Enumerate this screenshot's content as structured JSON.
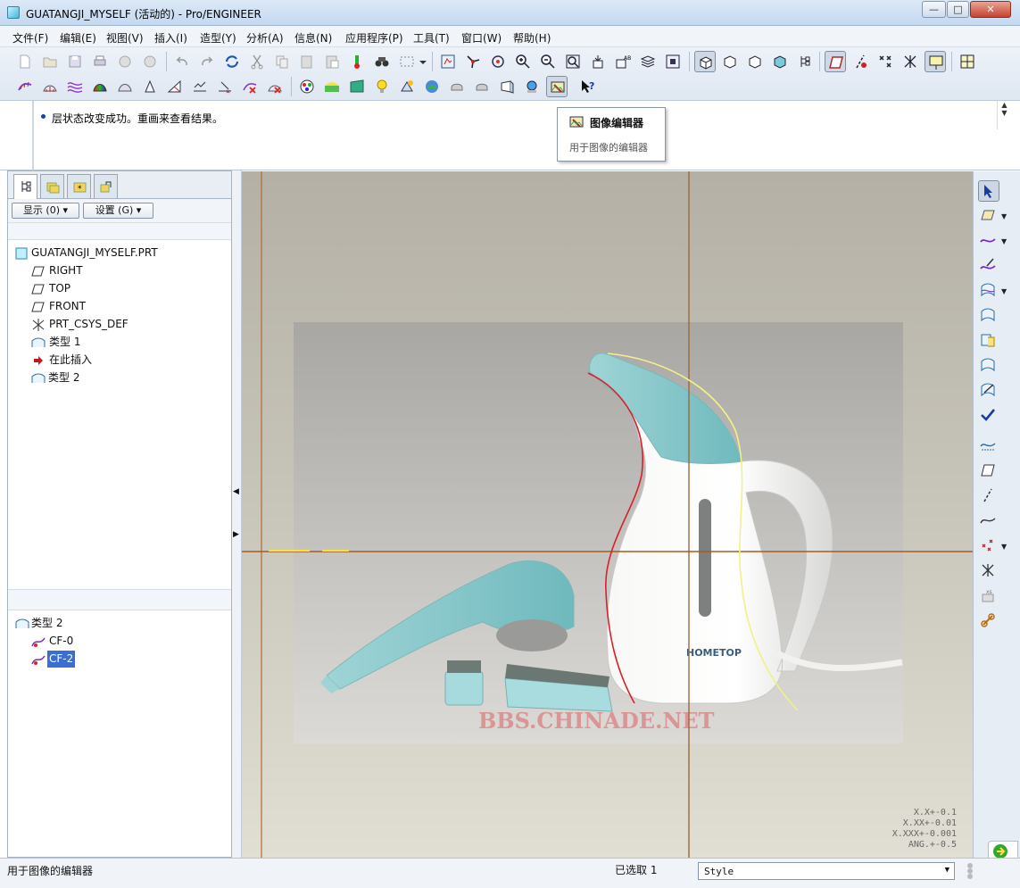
{
  "window": {
    "title": "GUATANGJI_MYSELF (活动的) - Pro/ENGINEER",
    "minimize": "—",
    "maximize": "□",
    "close": "✕"
  },
  "menu": [
    "文件(F)",
    "编辑(E)",
    "视图(V)",
    "插入(I)",
    "造型(Y)",
    "分析(A)",
    "信息(N)",
    "应用程序(P)",
    "工具(T)",
    "窗口(W)",
    "帮助(H)"
  ],
  "message": "层状态改变成功。重画来查看结果。",
  "tooltip": {
    "title": "图像编辑器",
    "description": "用于图像的编辑器"
  },
  "left_panel": {
    "show_button": "显示 (0) ▾",
    "settings_button": "设置 (G) ▾",
    "model_tree": [
      {
        "label": "GUATANGJI_MYSELF.PRT",
        "icon": "part-icon"
      },
      {
        "label": "RIGHT",
        "icon": "datum-plane-icon"
      },
      {
        "label": "TOP",
        "icon": "datum-plane-icon"
      },
      {
        "label": "FRONT",
        "icon": "datum-plane-icon"
      },
      {
        "label": "PRT_CSYS_DEF",
        "icon": "csys-icon"
      },
      {
        "label": "类型 1",
        "icon": "style-feature-icon"
      },
      {
        "label": "在此插入",
        "icon": "insert-here-arrow-icon"
      },
      {
        "label": "类型 2",
        "icon": "style-feature-icon"
      }
    ],
    "style_tree": [
      {
        "label": "类型 2",
        "icon": "style-feature-icon"
      },
      {
        "label": "CF-0",
        "icon": "style-curve-icon"
      },
      {
        "label": "CF-2",
        "icon": "style-curve-icon",
        "selected": true
      }
    ]
  },
  "graphics": {
    "watermark": "BBS.CHINADE.NET",
    "logo_text": "HOMETOP",
    "tolerances": [
      "X.X+-0.1",
      "X.XX+-0.01",
      "X.XXX+-0.001",
      "ANG.+-0.5"
    ]
  },
  "status": {
    "text": "用于图像的编辑器",
    "selected": "已选取 1",
    "style_value": "Style"
  },
  "colors": {
    "reference_line": "#b76a2a",
    "curve_red": "#d9202b",
    "curve_yellow": "#f2f08a",
    "steamer_teal": "#8cc9cc"
  }
}
